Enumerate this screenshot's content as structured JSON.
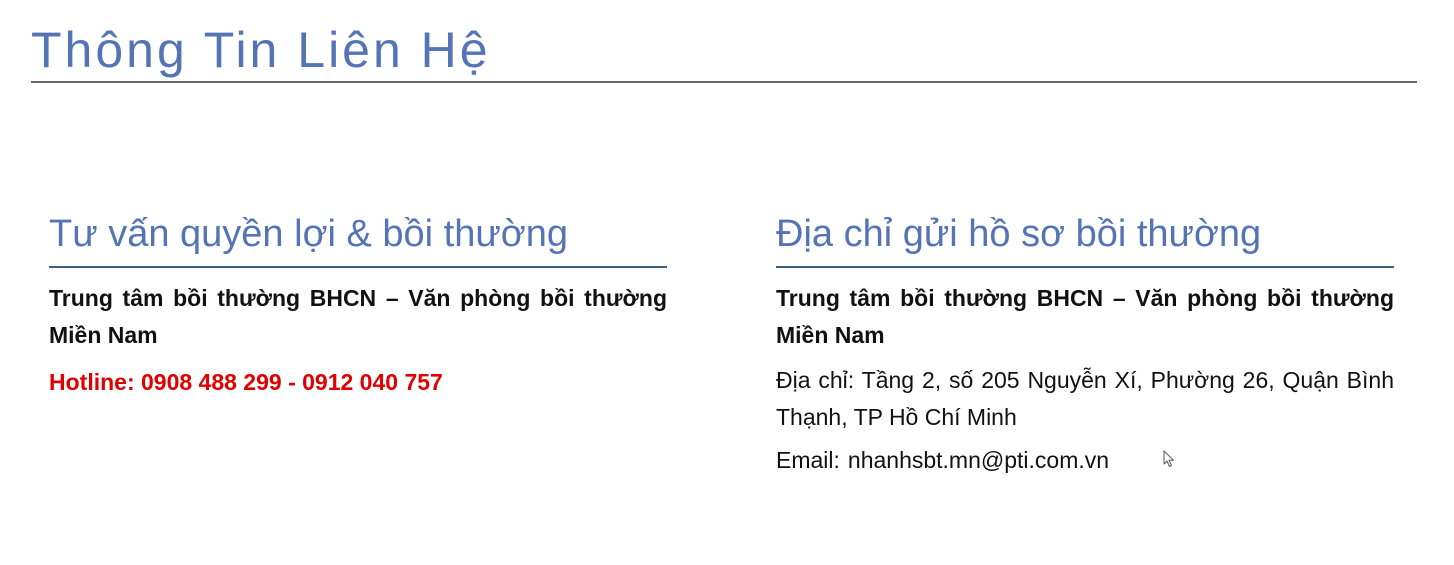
{
  "colors": {
    "heading": "#5474b6",
    "hotline": "#e00000",
    "text": "#111111"
  },
  "page": {
    "title": "Thông Tin Liên Hệ"
  },
  "left_section": {
    "heading": "Tư vấn quyền lợi & bồi thường",
    "office_name": "Trung tâm bồi thường BHCN – Văn phòng bồi thường Miền Nam",
    "hotline": "Hotline: 0908 488 299 - 0912 040 757"
  },
  "right_section": {
    "heading": "Địa chỉ gửi hồ sơ bồi thường",
    "office_name": "Trung tâm bồi thường BHCN – Văn phòng bồi thường Miền Nam",
    "address": "Địa chỉ: Tầng 2, số 205 Nguyễn Xí, Phường 26, Quận Bình Thạnh, TP Hồ Chí Minh",
    "email_label": "Email:",
    "email_value": "nhanhsbt.mn@pti.com.vn"
  },
  "icons": {
    "cursor": "mouse-pointer-icon"
  }
}
